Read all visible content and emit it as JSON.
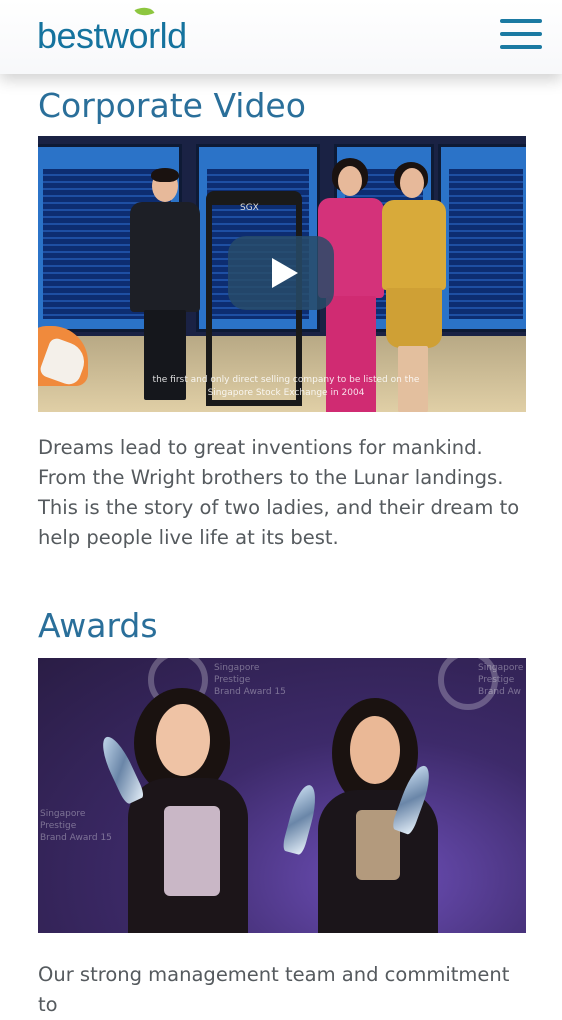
{
  "header": {
    "logo_text_before": "bestw",
    "logo_text_o": "o",
    "logo_text_after": "rld",
    "menu_icon": "hamburger-menu-icon",
    "brand_color": "#15739e",
    "leaf_color": "#8dc63f"
  },
  "video_section": {
    "title": "Corporate Video",
    "bell_label": "SGX",
    "video_caption": "the first and only direct selling company to be listed on the Singapore Stock Exchange in 2004",
    "play_icon": "play-icon",
    "description": "Dreams lead to great inventions for mankind. From the Wright brothers to the Lunar landings. This is the story of two ladies, and their dream to help people live life at its best."
  },
  "awards_section": {
    "title": "Awards",
    "banner_left": "Singapore\nPrestige\nBrand Award 15",
    "banner_right": "Singapore\nPrestige\nBrand Aw",
    "banner_lower": "Singapore\nPrestige\nBrand Award 15",
    "description_partial": "Our strong management team and commitment to"
  },
  "colors": {
    "title": "#2a6f9a",
    "body_text": "#555a5e"
  }
}
